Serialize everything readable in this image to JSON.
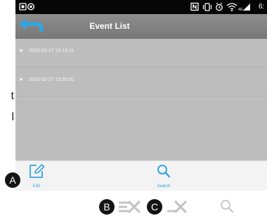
{
  "left_margin_text": [
    "t",
    "l"
  ],
  "status_bar": {
    "time": "6:"
  },
  "header": {
    "title": "Event List",
    "back_icon": "back-arrow-icon"
  },
  "events": [
    {
      "label": "2016-02-17 16:10:11"
    },
    {
      "label": "2016-02-17 15:55:01"
    }
  ],
  "event_marker": "★",
  "toolbar": {
    "edit_label": "Edit",
    "search_label": "Search"
  },
  "callouts": {
    "a": "A",
    "b": "B",
    "c": "C"
  },
  "colors": {
    "accent": "#35a4e0",
    "header": "#818181",
    "list_background": "#bdbdbd",
    "status_bar": "#050505"
  }
}
